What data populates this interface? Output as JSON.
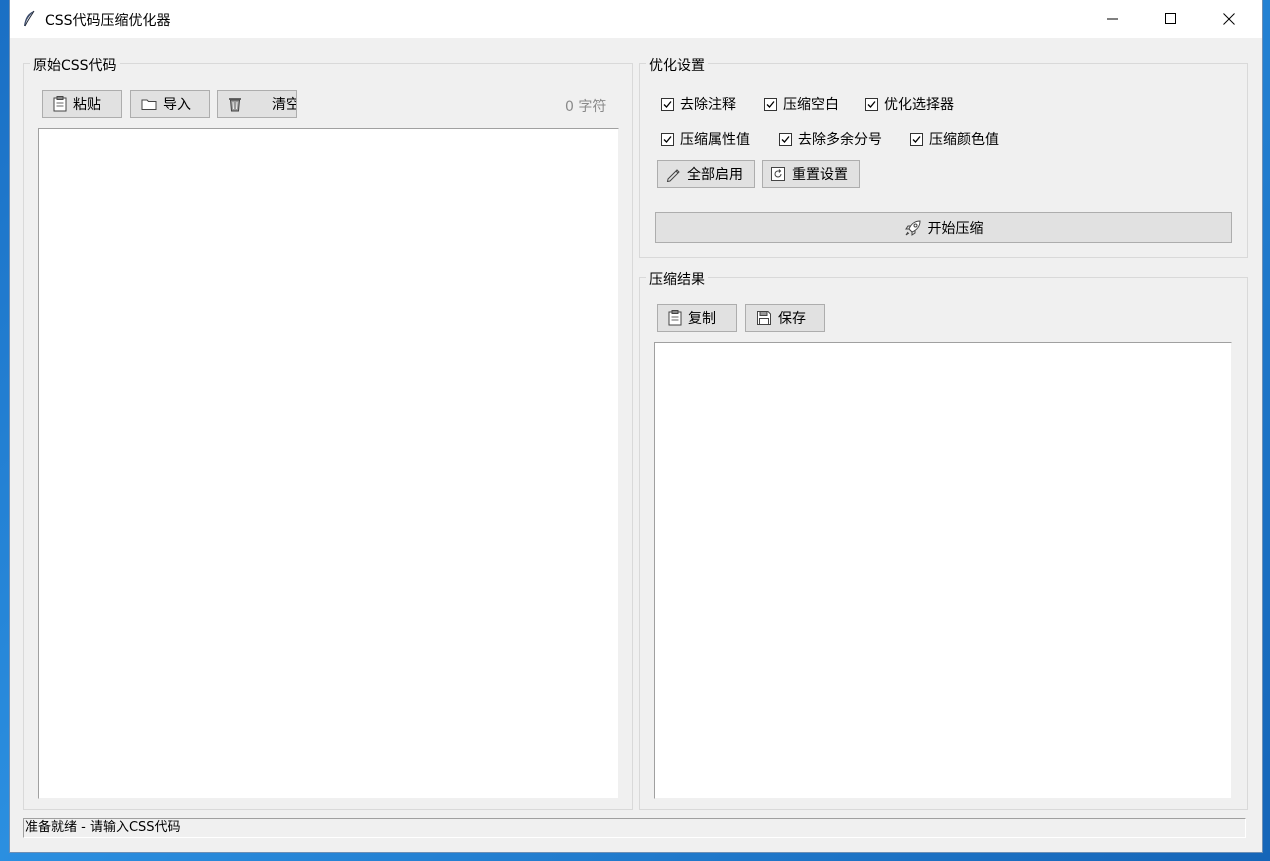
{
  "window": {
    "title": "CSS代码压缩优化器",
    "icon": "feather-icon"
  },
  "input_panel": {
    "title": "原始CSS代码",
    "paste_label": "粘贴",
    "import_label": "导入",
    "clear_label": "清空",
    "char_count": "0 字符",
    "value": ""
  },
  "settings": {
    "title": "优化设置",
    "options": [
      {
        "label": "去除注释",
        "checked": true
      },
      {
        "label": "压缩空白",
        "checked": true
      },
      {
        "label": "优化选择器",
        "checked": true
      },
      {
        "label": "压缩属性值",
        "checked": true
      },
      {
        "label": "去除多余分号",
        "checked": true
      },
      {
        "label": "压缩颜色值",
        "checked": true
      }
    ],
    "enable_all_label": "全部启用",
    "reset_label": "重置设置",
    "start_label": "开始压缩"
  },
  "result_panel": {
    "title": "压缩结果",
    "copy_label": "复制",
    "save_label": "保存",
    "value": ""
  },
  "status": {
    "text": "准备就绪 - 请输入CSS代码"
  }
}
